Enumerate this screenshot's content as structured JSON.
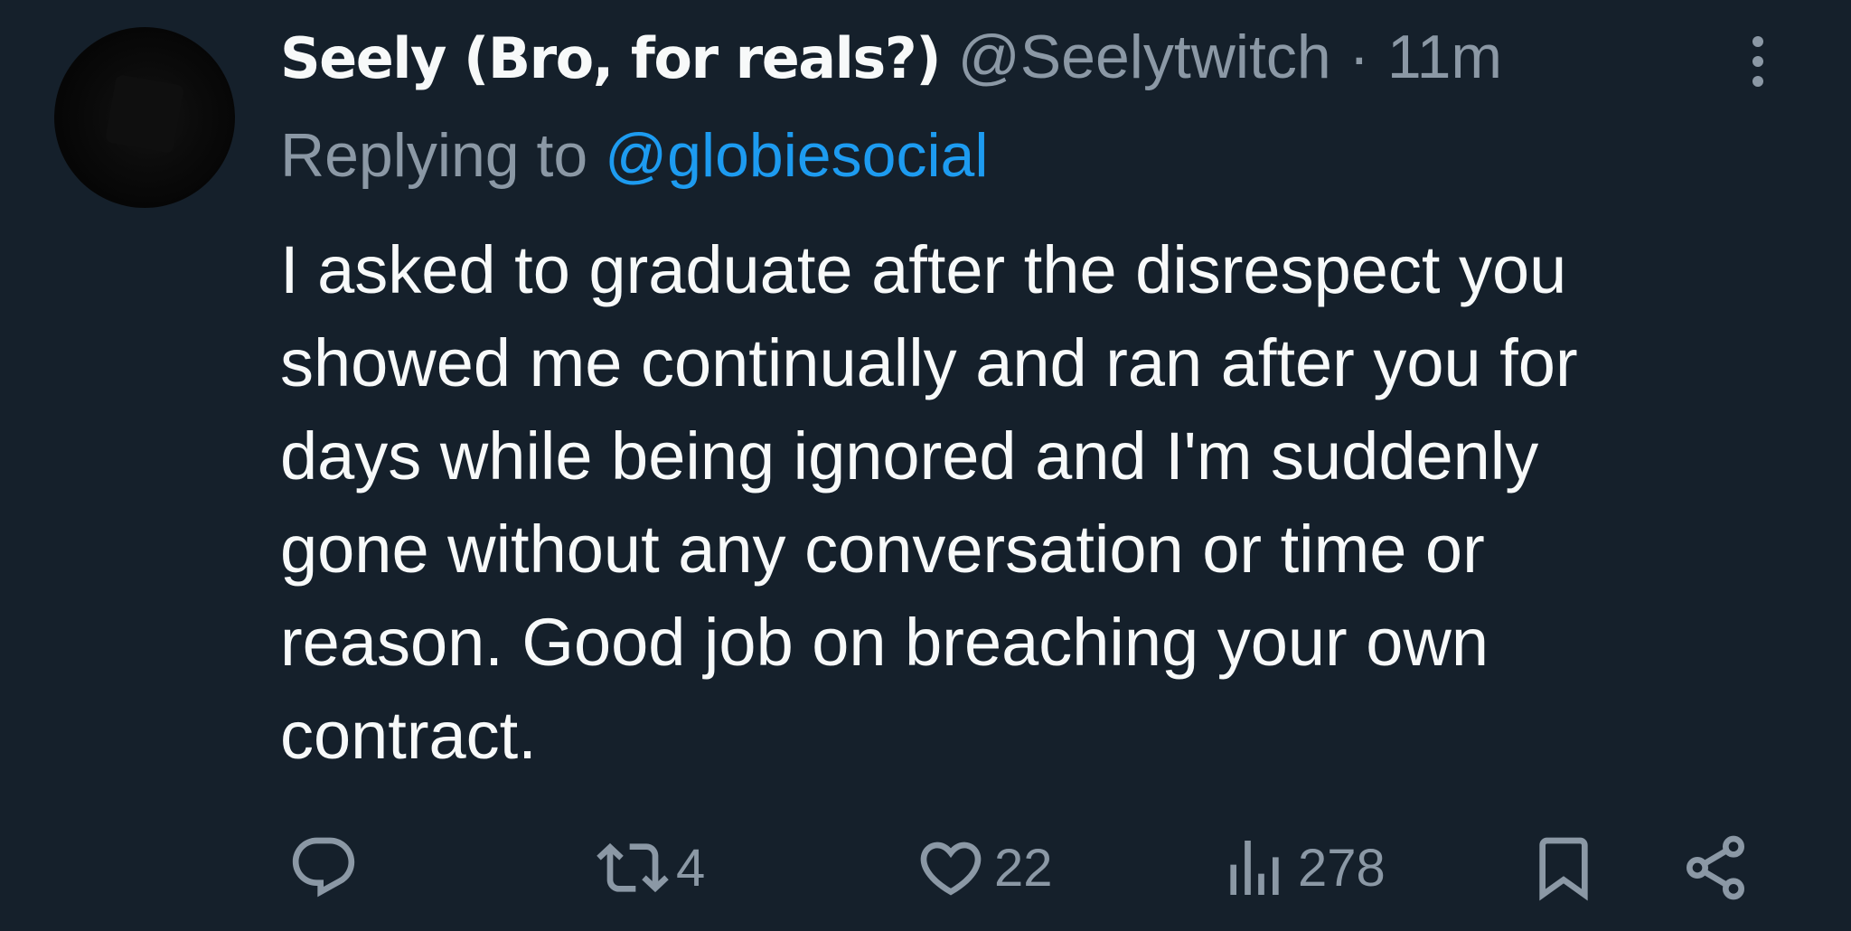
{
  "tweet": {
    "display_name": "Seely (Bro, for reals?)",
    "handle": "@Seelytwitch",
    "separator": "·",
    "time": "11m",
    "replying_prefix": "Replying to",
    "replying_handle": "@globiesocial",
    "body_lines": [
      "I asked to graduate after the disrespect you",
      "showed me continually and ran after you for",
      "days while being ignored and I'm suddenly",
      "gone without any conversation or time or",
      "reason. Good job on breaching your own",
      "contract."
    ]
  },
  "actions": {
    "reply": {
      "icon": "reply-icon",
      "count": ""
    },
    "retweet": {
      "icon": "retweet-icon",
      "count": "4"
    },
    "like": {
      "icon": "heart-icon",
      "count": "22"
    },
    "views": {
      "icon": "views-icon",
      "count": "278"
    },
    "bookmark": {
      "icon": "bookmark-icon",
      "count": ""
    },
    "share": {
      "icon": "share-icon",
      "count": ""
    }
  },
  "colors": {
    "background": "#15202b",
    "text_primary": "#f7f9f9",
    "text_secondary": "#8b98a5",
    "link": "#1d9bf0"
  }
}
